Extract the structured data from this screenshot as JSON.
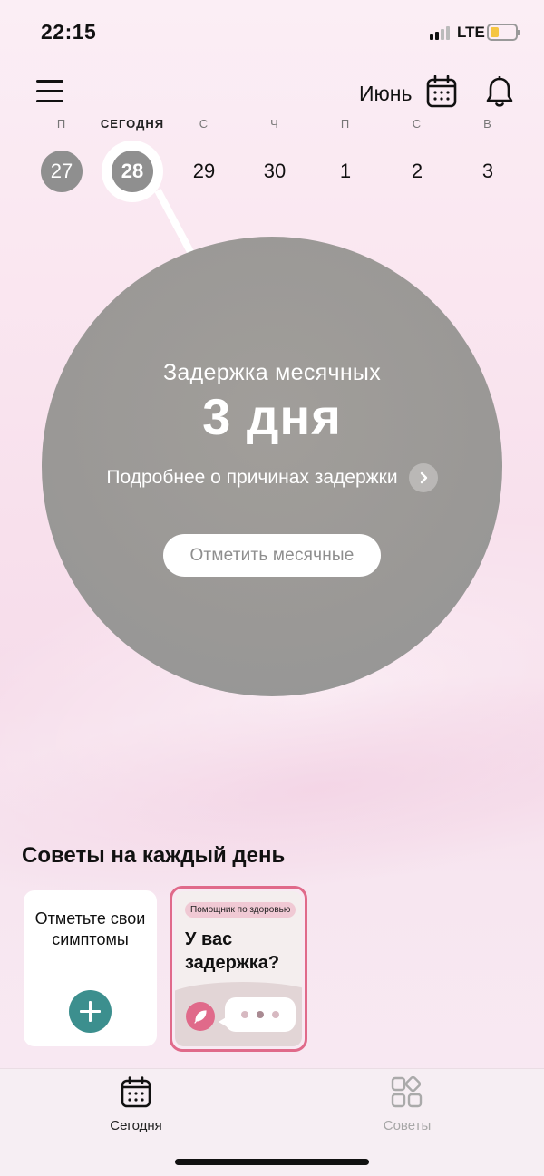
{
  "status_bar": {
    "time": "22:15",
    "network": "LTE"
  },
  "header": {
    "month": "Июнь"
  },
  "week": [
    {
      "label": "П",
      "day": "27",
      "state": "past"
    },
    {
      "label": "СЕГОДНЯ",
      "day": "28",
      "state": "today"
    },
    {
      "label": "С",
      "day": "29",
      "state": "future"
    },
    {
      "label": "Ч",
      "day": "30",
      "state": "future"
    },
    {
      "label": "П",
      "day": "1",
      "state": "future"
    },
    {
      "label": "С",
      "day": "2",
      "state": "future"
    },
    {
      "label": "В",
      "day": "3",
      "state": "future"
    }
  ],
  "cycle": {
    "caption": "Задержка месячных",
    "value": "3 дня",
    "details_link": "Подробнее о причинах задержки",
    "mark_button": "Отметить месячные"
  },
  "tips": {
    "title": "Советы на каждый день",
    "symptoms_card": "Отметьте свои симптомы",
    "story_card": {
      "badge": "Помощник по здоровью",
      "headline": "У вас задержка?"
    }
  },
  "tabbar": {
    "today": "Сегодня",
    "tips": "Советы"
  },
  "colors": {
    "accent": "#3c8f8e",
    "story_border": "#e06a8a",
    "circle": "#9a9896"
  }
}
